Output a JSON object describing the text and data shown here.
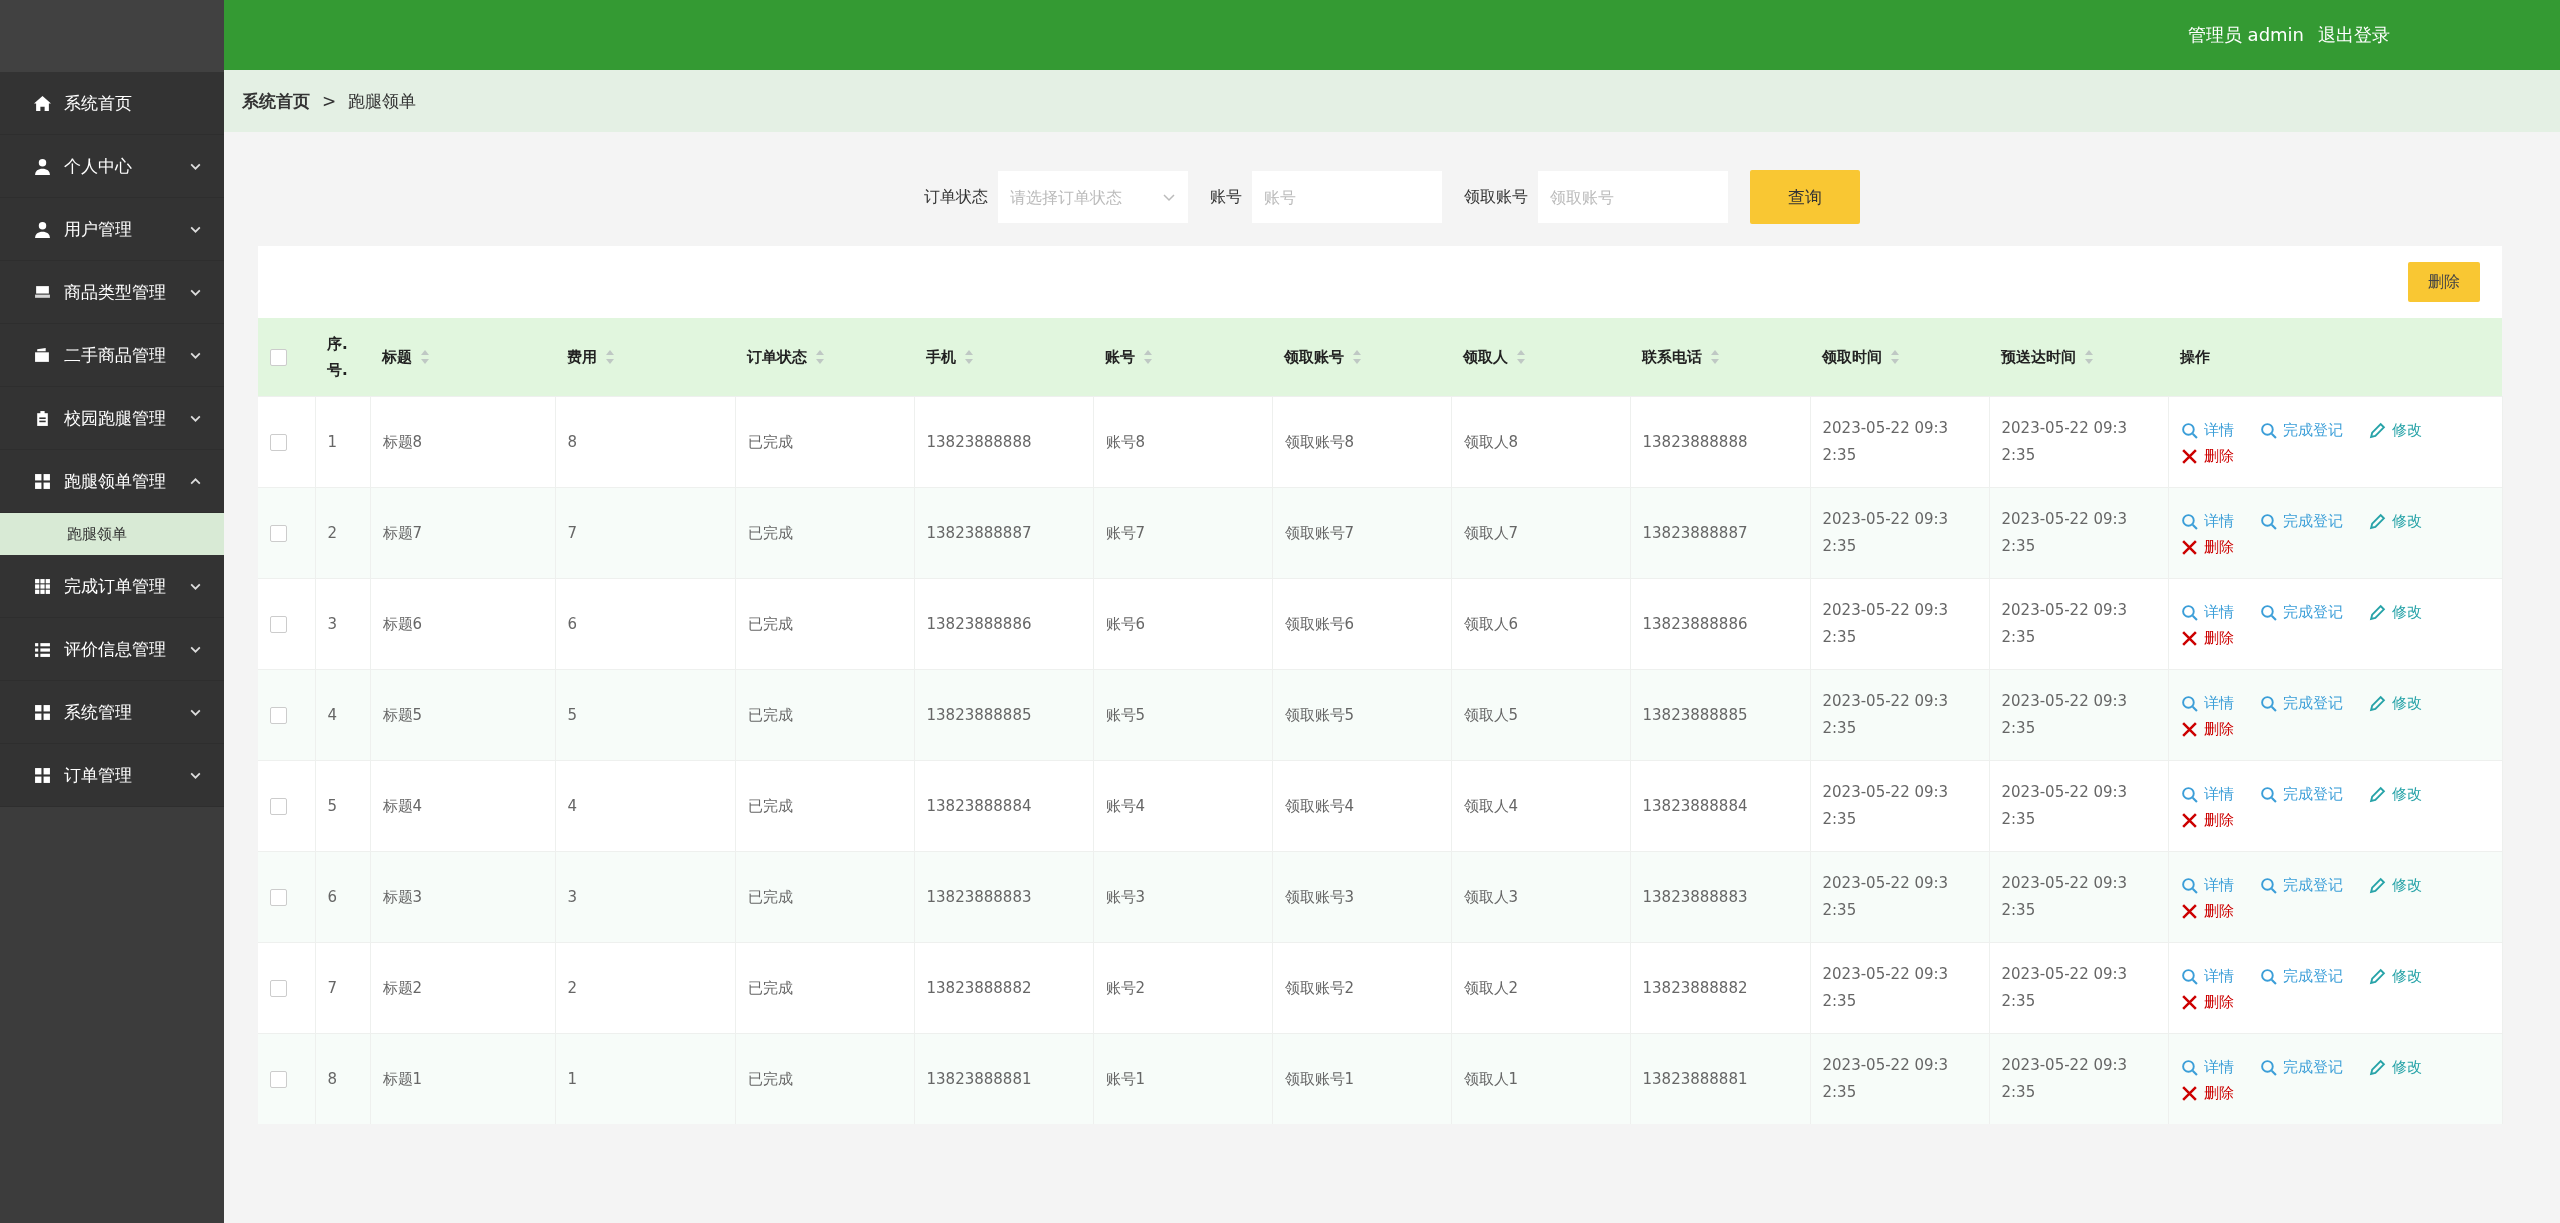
{
  "header": {
    "user_label": "管理员 admin",
    "logout": "退出登录"
  },
  "sidebar": {
    "items": [
      {
        "label": "系统首页"
      },
      {
        "label": "个人中心",
        "expanded": false
      },
      {
        "label": "用户管理",
        "expanded": false
      },
      {
        "label": "商品类型管理",
        "expanded": false
      },
      {
        "label": "二手商品管理",
        "expanded": false
      },
      {
        "label": "校园跑腿管理",
        "expanded": false
      },
      {
        "label": "跑腿领单管理",
        "expanded": true,
        "children": [
          {
            "label": "跑腿领单",
            "selected": true
          }
        ]
      },
      {
        "label": "完成订单管理",
        "expanded": false
      },
      {
        "label": "评价信息管理",
        "expanded": false
      },
      {
        "label": "系统管理",
        "expanded": false
      },
      {
        "label": "订单管理",
        "expanded": false
      }
    ]
  },
  "breadcrumb": {
    "home": "系统首页",
    "separator": ">",
    "current": "跑腿领单"
  },
  "search": {
    "fields": [
      {
        "kind": "select",
        "label": "订单状态",
        "placeholder": "请选择订单状态"
      },
      {
        "kind": "input",
        "label": "账号",
        "placeholder": "账号"
      },
      {
        "kind": "input",
        "label": "领取账号",
        "placeholder": "领取账号"
      }
    ],
    "button": "查询"
  },
  "table": {
    "delete_button": "删除",
    "all_checked": false,
    "columns": [
      {
        "label": "序.号.",
        "sortable": false
      },
      {
        "label": "标题",
        "sortable": true
      },
      {
        "label": "费用",
        "sortable": true
      },
      {
        "label": "订单状态",
        "sortable": true
      },
      {
        "label": "手机",
        "sortable": true
      },
      {
        "label": "账号",
        "sortable": true
      },
      {
        "label": "领取账号",
        "sortable": true
      },
      {
        "label": "领取人",
        "sortable": true
      },
      {
        "label": "联系电话",
        "sortable": true
      },
      {
        "label": "领取时间",
        "sortable": true
      },
      {
        "label": "预送达时间",
        "sortable": true
      },
      {
        "label": "操作",
        "sortable": false
      }
    ],
    "rows": [
      {
        "checked": false,
        "actions": [
          {
            "kind": "view",
            "label": "详情"
          },
          {
            "kind": "complete",
            "label": "完成登记"
          },
          {
            "kind": "edit",
            "label": "修改"
          },
          {
            "kind": "delete",
            "label": "删除"
          }
        ],
        "cells": [
          "1",
          "标题8",
          "8",
          "已完成",
          "13823888888",
          "账号8",
          "领取账号8",
          "领取人8",
          "13823888888",
          "2023-05-22 09:32:35",
          "2023-05-22 09:32:35"
        ]
      },
      {
        "checked": false,
        "actions": [
          {
            "kind": "view",
            "label": "详情"
          },
          {
            "kind": "complete",
            "label": "完成登记"
          },
          {
            "kind": "edit",
            "label": "修改"
          },
          {
            "kind": "delete",
            "label": "删除"
          }
        ],
        "cells": [
          "2",
          "标题7",
          "7",
          "已完成",
          "13823888887",
          "账号7",
          "领取账号7",
          "领取人7",
          "13823888887",
          "2023-05-22 09:32:35",
          "2023-05-22 09:32:35"
        ]
      },
      {
        "checked": false,
        "actions": [
          {
            "kind": "view",
            "label": "详情"
          },
          {
            "kind": "complete",
            "label": "完成登记"
          },
          {
            "kind": "edit",
            "label": "修改"
          },
          {
            "kind": "delete",
            "label": "删除"
          }
        ],
        "cells": [
          "3",
          "标题6",
          "6",
          "已完成",
          "13823888886",
          "账号6",
          "领取账号6",
          "领取人6",
          "13823888886",
          "2023-05-22 09:32:35",
          "2023-05-22 09:32:35"
        ]
      },
      {
        "checked": false,
        "actions": [
          {
            "kind": "view",
            "label": "详情"
          },
          {
            "kind": "complete",
            "label": "完成登记"
          },
          {
            "kind": "edit",
            "label": "修改"
          },
          {
            "kind": "delete",
            "label": "删除"
          }
        ],
        "cells": [
          "4",
          "标题5",
          "5",
          "已完成",
          "13823888885",
          "账号5",
          "领取账号5",
          "领取人5",
          "13823888885",
          "2023-05-22 09:32:35",
          "2023-05-22 09:32:35"
        ]
      },
      {
        "checked": false,
        "actions": [
          {
            "kind": "view",
            "label": "详情"
          },
          {
            "kind": "complete",
            "label": "完成登记"
          },
          {
            "kind": "edit",
            "label": "修改"
          },
          {
            "kind": "delete",
            "label": "删除"
          }
        ],
        "cells": [
          "5",
          "标题4",
          "4",
          "已完成",
          "13823888884",
          "账号4",
          "领取账号4",
          "领取人4",
          "13823888884",
          "2023-05-22 09:32:35",
          "2023-05-22 09:32:35"
        ]
      },
      {
        "checked": false,
        "actions": [
          {
            "kind": "view",
            "label": "详情"
          },
          {
            "kind": "complete",
            "label": "完成登记"
          },
          {
            "kind": "edit",
            "label": "修改"
          },
          {
            "kind": "delete",
            "label": "删除"
          }
        ],
        "cells": [
          "6",
          "标题3",
          "3",
          "已完成",
          "13823888883",
          "账号3",
          "领取账号3",
          "领取人3",
          "13823888883",
          "2023-05-22 09:32:35",
          "2023-05-22 09:32:35"
        ]
      },
      {
        "checked": false,
        "actions": [
          {
            "kind": "view",
            "label": "详情"
          },
          {
            "kind": "complete",
            "label": "完成登记"
          },
          {
            "kind": "edit",
            "label": "修改"
          },
          {
            "kind": "delete",
            "label": "删除"
          }
        ],
        "cells": [
          "7",
          "标题2",
          "2",
          "已完成",
          "13823888882",
          "账号2",
          "领取账号2",
          "领取人2",
          "13823888882",
          "2023-05-22 09:32:35",
          "2023-05-22 09:32:35"
        ]
      },
      {
        "checked": false,
        "actions": [
          {
            "kind": "view",
            "label": "详情"
          },
          {
            "kind": "complete",
            "label": "完成登记"
          },
          {
            "kind": "edit",
            "label": "修改"
          },
          {
            "kind": "delete",
            "label": "删除"
          }
        ],
        "cells": [
          "8",
          "标题1",
          "1",
          "已完成",
          "13823888881",
          "账号1",
          "领取账号1",
          "领取人1",
          "13823888881",
          "2023-05-22 09:32:35",
          "2023-05-22 09:32:35"
        ]
      }
    ]
  }
}
